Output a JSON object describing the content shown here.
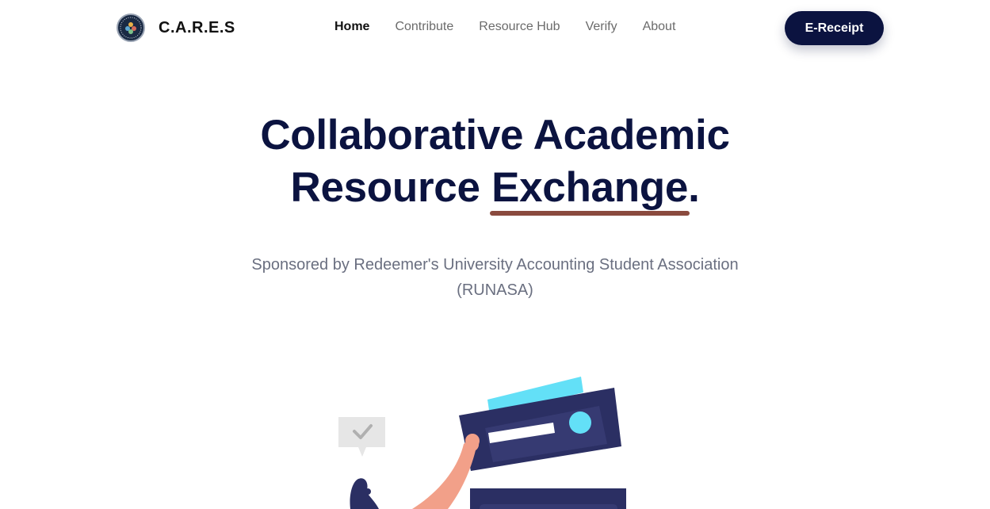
{
  "brand": {
    "name": "C.A.R.E.S"
  },
  "nav": {
    "items": [
      {
        "label": "Home",
        "active": true
      },
      {
        "label": "Contribute",
        "active": false
      },
      {
        "label": "Resource Hub",
        "active": false
      },
      {
        "label": "Verify",
        "active": false
      },
      {
        "label": "About",
        "active": false
      }
    ],
    "cta_label": "E-Receipt"
  },
  "hero": {
    "title_line1": "Collaborative Academic",
    "title_line2_prefix": "Resource ",
    "title_highlight": "Exchange",
    "title_suffix": ".",
    "subtitle_line1": "Sponsored by Redeemer's University Accounting Student Association",
    "subtitle_line2": "(RUNASA)"
  },
  "colors": {
    "primary_dark": "#0b1340",
    "underline": "#8a4a3e",
    "accent_cyan": "#63e0f7",
    "skin": "#f2a089",
    "card_navy": "#2b2f63"
  },
  "icons": {
    "brand_logo": "seal-logo",
    "speech_bubble": "check-speech-bubble"
  }
}
